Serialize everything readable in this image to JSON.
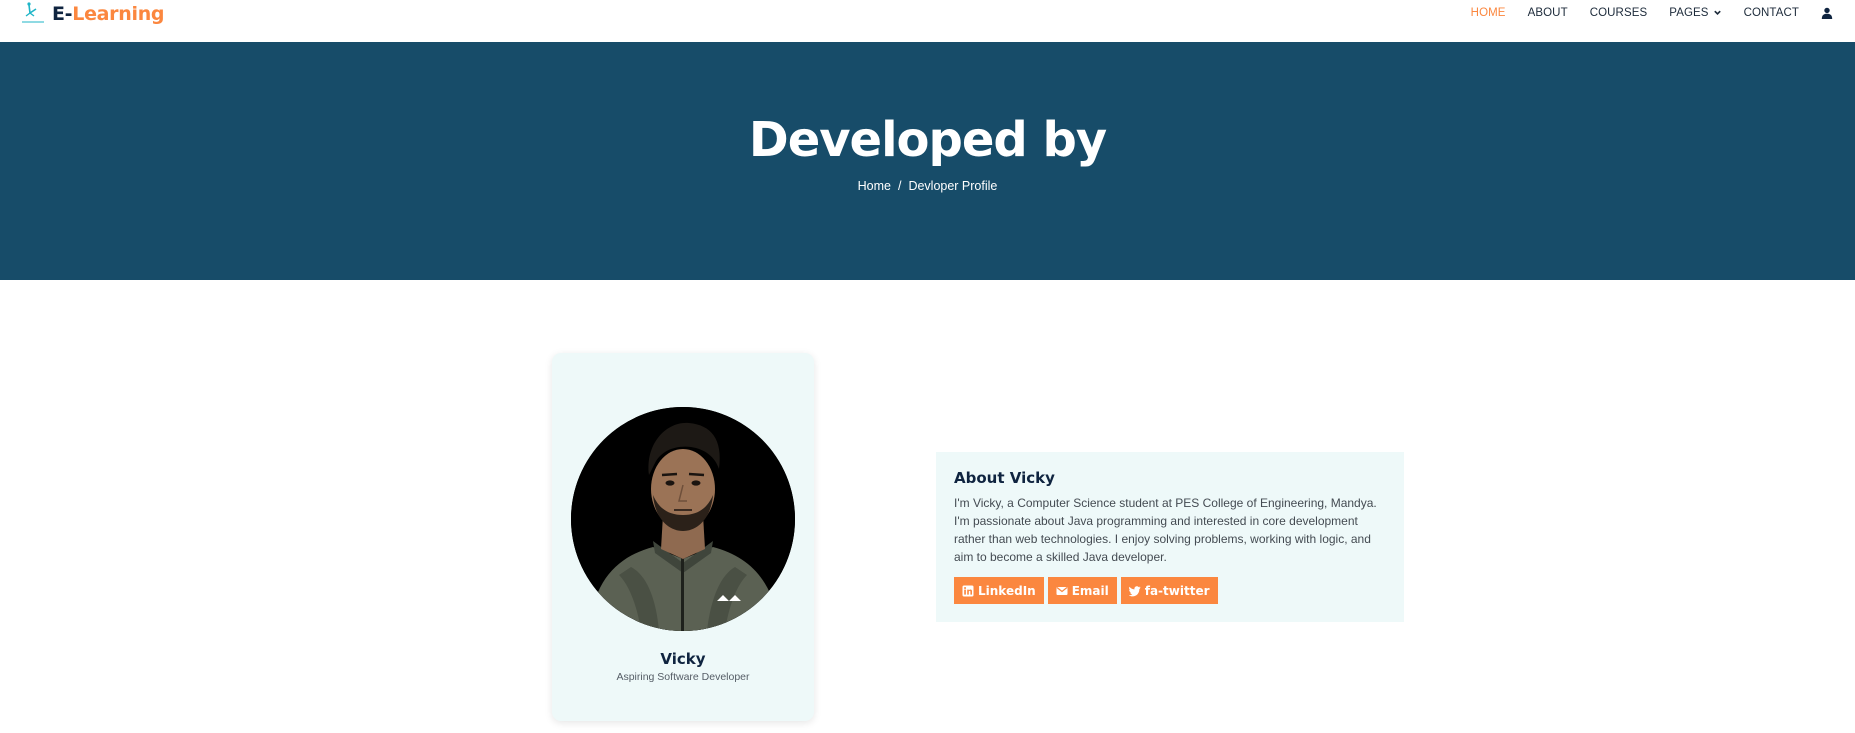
{
  "brand": {
    "prefix": "E-",
    "name": "Learning"
  },
  "nav": {
    "items": [
      {
        "label": "HOME",
        "active": true
      },
      {
        "label": "ABOUT",
        "active": false
      },
      {
        "label": "COURSES",
        "active": false
      },
      {
        "label": "PAGES",
        "active": false,
        "has_dropdown": true
      },
      {
        "label": "CONTACT",
        "active": false
      }
    ],
    "user_icon": "user-icon"
  },
  "hero": {
    "title": "Developed by",
    "breadcrumb": {
      "home": "Home",
      "separator": "/",
      "current": "Devloper Profile"
    }
  },
  "profile": {
    "name": "Vicky",
    "role": "Aspiring Software Developer"
  },
  "about": {
    "title": "About Vicky",
    "text": "I'm Vicky, a Computer Science student at PES College of Engineering, Mandya. I'm passionate about Java programming and interested in core development rather than web technologies. I enjoy solving problems, working with logic, and aim to become a skilled Java developer.",
    "buttons": [
      {
        "label": "LinkedIn",
        "icon": "linkedin-icon"
      },
      {
        "label": "Email",
        "icon": "envelope-icon"
      },
      {
        "label": "fa-twitter",
        "icon": "twitter-icon"
      }
    ]
  },
  "colors": {
    "accent": "#fb873f",
    "hero_bg": "#174c69",
    "card_bg": "#eef9f9",
    "dark_text": "#0f2440"
  }
}
